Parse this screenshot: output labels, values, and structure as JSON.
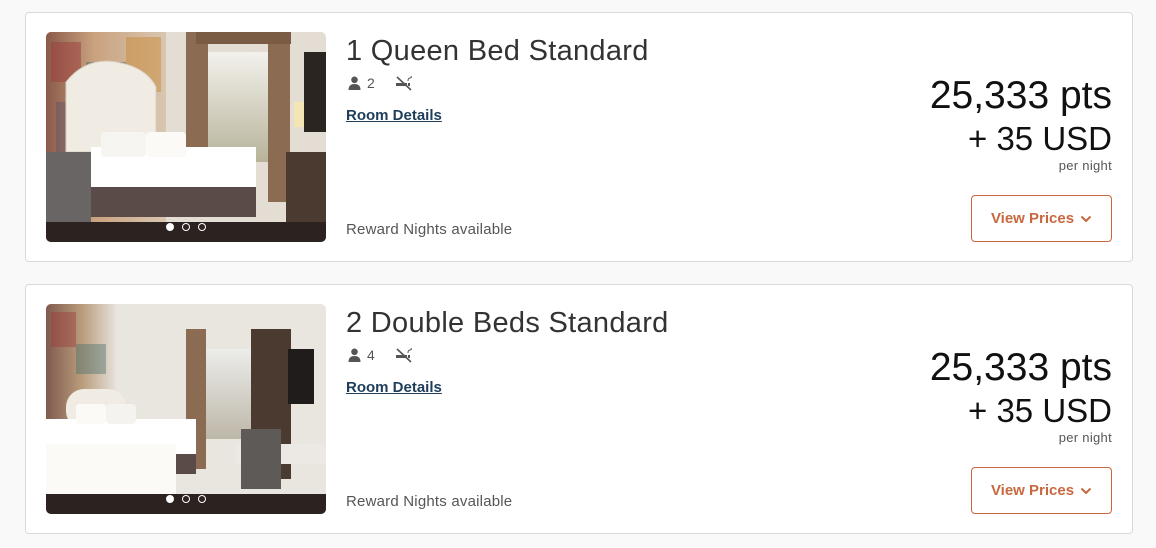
{
  "rooms": [
    {
      "title": "1 Queen Bed Standard",
      "guests": "2",
      "guest_icon": "person-icon",
      "smoking_icon": "no-smoking-icon",
      "details_link": "Room Details",
      "reward_text": "Reward Nights available",
      "points": "25,333 pts",
      "cash": "+ 35 USD",
      "per_night": "per night",
      "button_label": "View Prices",
      "button_icon": "chevron-down-icon",
      "photo_slides": 3,
      "active_slide": 1
    },
    {
      "title": "2 Double Beds Standard",
      "guests": "4",
      "guest_icon": "person-icon",
      "smoking_icon": "no-smoking-icon",
      "details_link": "Room Details",
      "reward_text": "Reward Nights available",
      "points": "25,333 pts",
      "cash": "+ 35 USD",
      "per_night": "per night",
      "button_label": "View Prices",
      "button_icon": "chevron-down-icon",
      "photo_slides": 3,
      "active_slide": 1
    }
  ],
  "colors": {
    "accent": "#c8683e",
    "link": "#1f3e5a",
    "border": "#d9d9d9"
  }
}
